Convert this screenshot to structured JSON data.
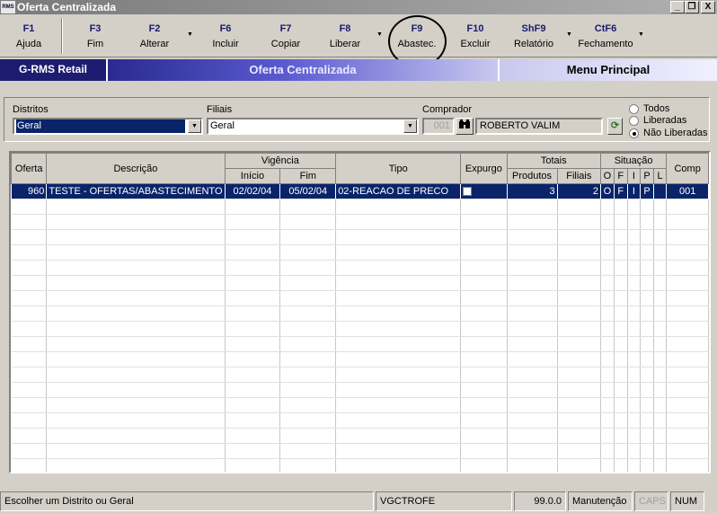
{
  "window": {
    "title": "Oferta Centralizada",
    "icon_text": "RMS",
    "minimize": "_",
    "restore": "❐",
    "close": "X"
  },
  "toolbar": [
    {
      "key": "F1",
      "label": "Ajuda"
    },
    {
      "key": "F3",
      "label": "Fim"
    },
    {
      "key": "F2",
      "label": "Alterar"
    },
    {
      "key": "F6",
      "label": "Incluir"
    },
    {
      "key": "F7",
      "label": "Copiar"
    },
    {
      "key": "F8",
      "label": "Liberar"
    },
    {
      "key": "F9",
      "label": "Abastec."
    },
    {
      "key": "F10",
      "label": "Excluir"
    },
    {
      "key": "ShF9",
      "label": "Relatório"
    },
    {
      "key": "CtF6",
      "label": "Fechamento"
    }
  ],
  "band": {
    "brand": "G-RMS Retail",
    "title": "Oferta Centralizada",
    "menu": "Menu Principal"
  },
  "filters": {
    "distritos_label": "Distritos",
    "distritos_value": "Geral",
    "filiais_label": "Filiais",
    "filiais_value": "Geral",
    "comprador_label": "Comprador",
    "comprador_code": "001",
    "comprador_name": "ROBERTO VALIM",
    "radio_todos": "Todos",
    "radio_liberadas": "Liberadas",
    "radio_nao_liberadas": "Não Liberadas",
    "selected_radio": "Não Liberadas"
  },
  "grid": {
    "headers": {
      "oferta": "Oferta",
      "descricao": "Descrição",
      "vigencia": "Vigência",
      "inicio": "Início",
      "fim": "Fim",
      "tipo": "Tipo",
      "expurgo": "Expurgo",
      "totais": "Totais",
      "produtos": "Produtos",
      "filiais": "Filiais",
      "situacao": "Situação",
      "s_o": "O",
      "s_f": "F",
      "s_i": "I",
      "s_p": "P",
      "s_l": "L",
      "comp": "Comp"
    },
    "rows": [
      {
        "oferta": "960",
        "descricao": "TESTE - OFERTAS/ABASTECIMENTO",
        "inicio": "02/02/04",
        "fim": "05/02/04",
        "tipo": "02-REACAO DE PRECO",
        "produtos": "3",
        "filiais": "2",
        "o": "O",
        "f": "F",
        "i": "I",
        "p": "P",
        "l": "",
        "comp": "001"
      }
    ]
  },
  "status": {
    "message": "Escolher um Distrito ou Geral",
    "program": "VGCTROFE",
    "version": "99.0.0",
    "mode": "Manutenção",
    "caps": "CAPS",
    "num": "NUM"
  }
}
